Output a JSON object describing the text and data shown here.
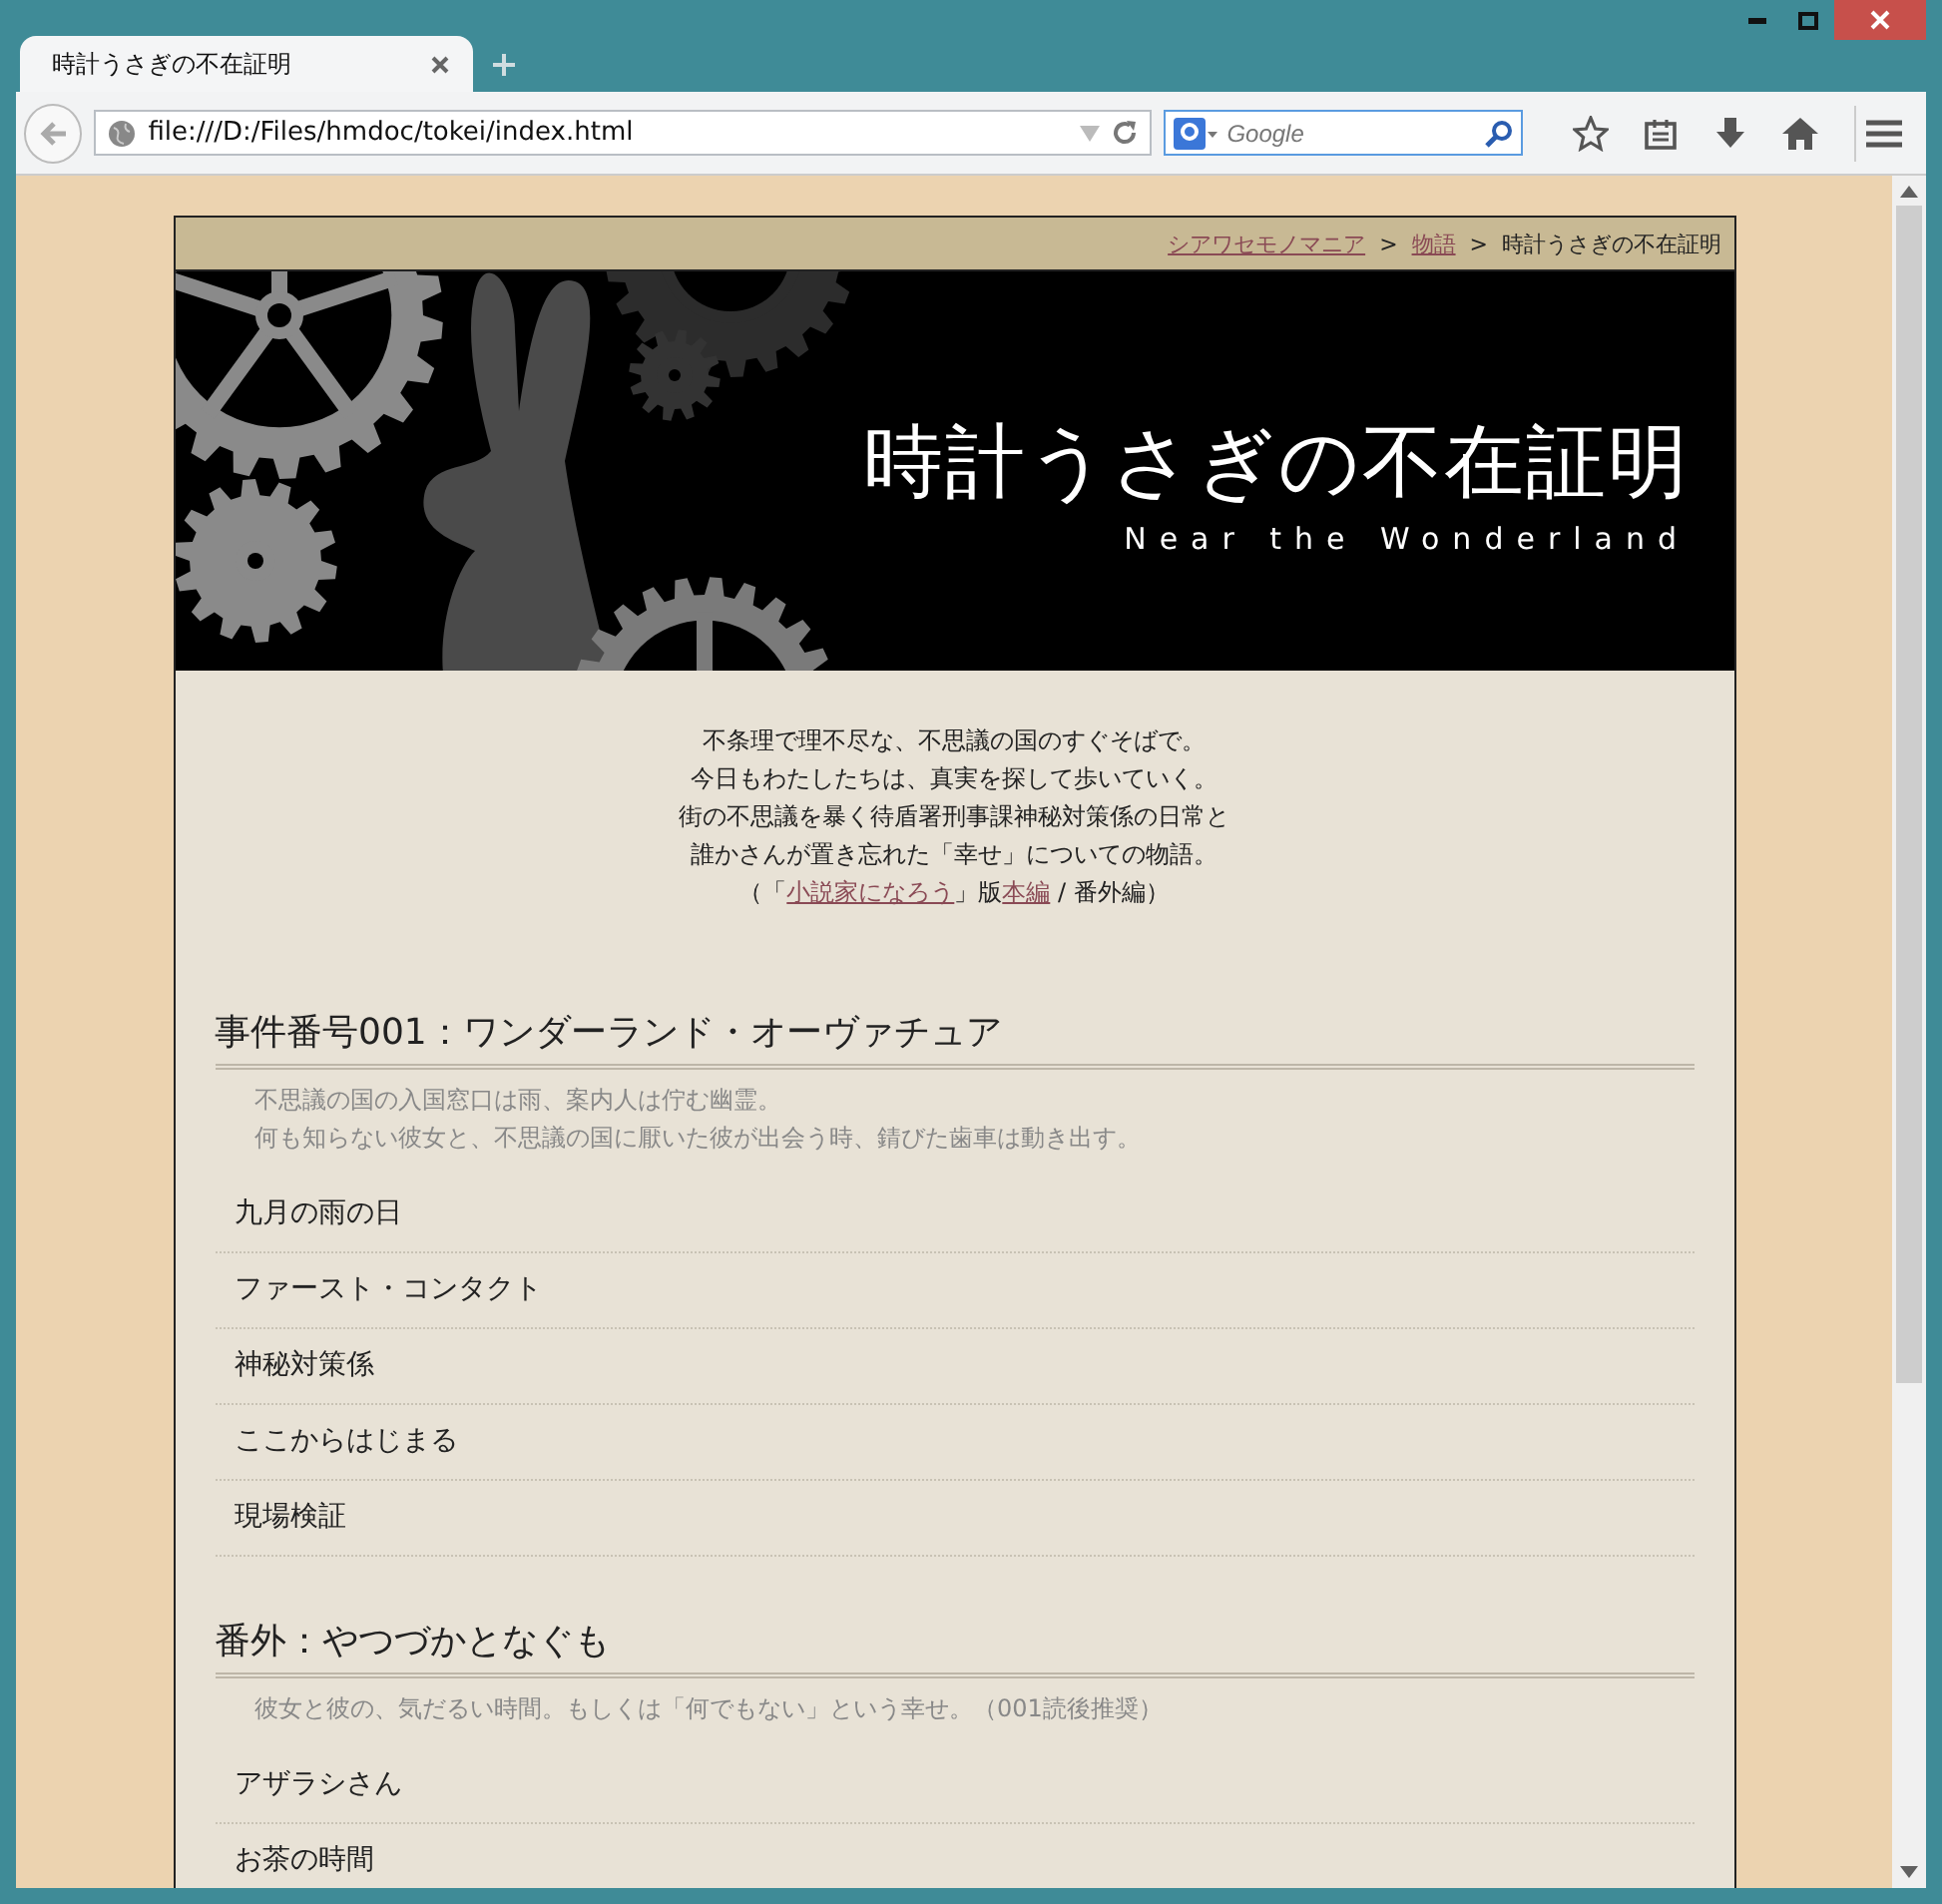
{
  "window": {
    "tab_title": "時計うさぎの不在証明",
    "url": "file:///D:/Files/hmdoc/tokei/index.html",
    "search": {
      "placeholder": "Google"
    }
  },
  "breadcrumb": [
    {
      "kind": "link",
      "text": "シアワセモノマニア"
    },
    {
      "kind": "separator",
      "text": ">"
    },
    {
      "kind": "link",
      "text": "物語"
    },
    {
      "kind": "separator",
      "text": ">"
    },
    {
      "kind": "current",
      "text": "時計うさぎの不在証明"
    }
  ],
  "banner": {
    "title": "時計うさぎの不在証明",
    "subtitle": "Near the Wonderland"
  },
  "intro": {
    "lines": [
      "不条理で理不尽な、不思議の国のすぐそばで。",
      "今日もわたしたちは、真実を探して歩いていく。",
      "街の不思議を暴く待盾署刑事課神秘対策係の日常と",
      "誰かさんが置き忘れた「幸せ」についての物語。"
    ],
    "links_line": [
      {
        "kind": "text",
        "text": "（「"
      },
      {
        "kind": "link",
        "text": "小説家になろう"
      },
      {
        "kind": "text",
        "text": "」版"
      },
      {
        "kind": "link",
        "text": "本編"
      },
      {
        "kind": "text",
        "text": " / 番外編）"
      }
    ]
  },
  "sections": [
    {
      "title": "事件番号001：ワンダーランド・オーヴァチュア",
      "description": [
        "不思議の国の入国窓口は雨、案内人は佇む幽霊。",
        "何も知らない彼女と、不思議の国に厭いた彼が出会う時、錆びた歯車は動き出す。"
      ],
      "chapters": [
        "九月の雨の日",
        "ファースト・コンタクト",
        "神秘対策係",
        "ここからはじまる",
        "現場検証"
      ]
    },
    {
      "title": "番外：やつづかとなぐも",
      "description": [
        "彼女と彼の、気だるい時間。もしくは「何でもない」という幸せ。（001読後推奨）"
      ],
      "chapters": [
        "アザラシさん",
        "お茶の時間"
      ]
    }
  ]
}
